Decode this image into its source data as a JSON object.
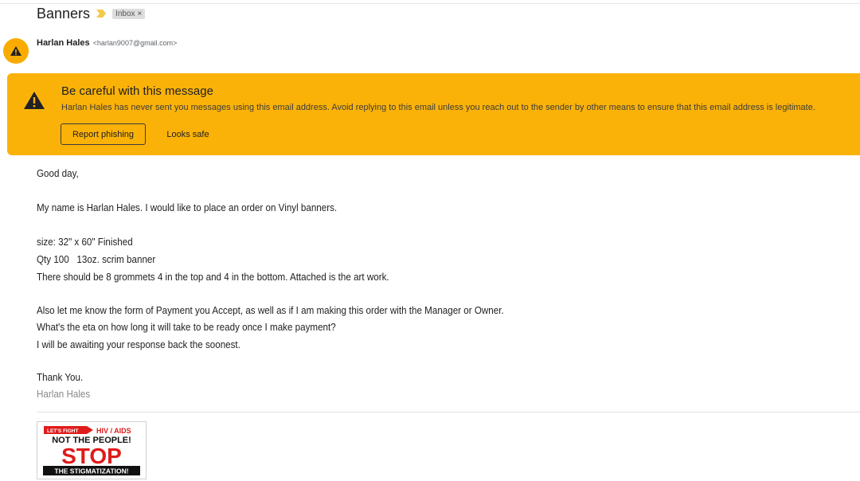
{
  "email": {
    "subject": "Banners",
    "label": "Inbox",
    "label_remove": "×",
    "sender_name": "Harlan Hales",
    "sender_email": "<harlan9007@gmail.com>"
  },
  "warning": {
    "title": "Be careful with this message",
    "text": "Harlan Hales has never sent you messages using this email address. Avoid replying to this email unless you reach out to the sender by other means to ensure that this email address is legitimate.",
    "report_button": "Report phishing",
    "safe_button": "Looks safe",
    "color": "#fbb208"
  },
  "body": {
    "greeting": "Good day,",
    "intro": "My name is Harlan Hales. I would like to place an order on Vinyl banners.",
    "size": "size: 32\" x 60\" Finished",
    "qty": "Qty 100   13oz. scrim banner",
    "grommets": "There should be 8 grommets 4 in the top and 4 in the bottom. Attached is the art work.",
    "payment": "Also let me know the form of Payment you Accept, as well as if I am making this order with the Manager or Owner.",
    "eta": "What's the eta on how long it will take to be ready once I make payment?",
    "awaiting": "I will be awaiting your response back the soonest.",
    "thanks": "Thank You.",
    "signature": "Harlan Hales"
  },
  "attachment": {
    "top_left": "LET'S FIGHT",
    "top_right": "HIV / AIDS",
    "line1": "NOT THE PEOPLE!",
    "line2": "STOP",
    "line3": "THE STIGMATIZATION!"
  }
}
